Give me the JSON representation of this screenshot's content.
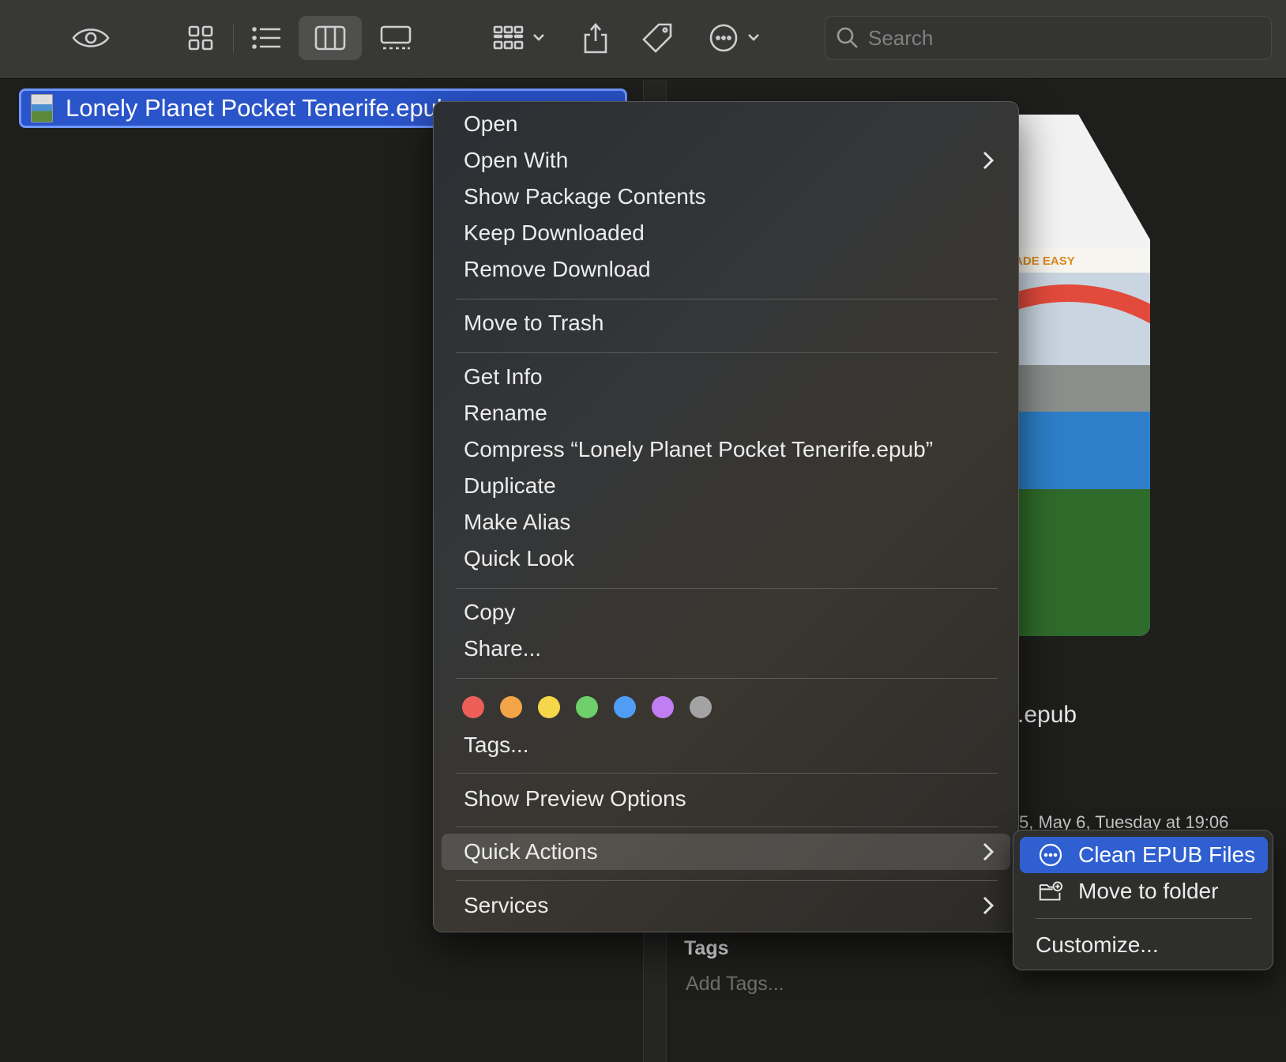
{
  "toolbar": {
    "search_placeholder": "Search",
    "icons": [
      "eye-icon",
      "icon-view-icon",
      "list-view-icon",
      "column-view-icon",
      "gallery-view-icon",
      "group-icon",
      "share-icon",
      "tag-icon",
      "more-icon",
      "search-icon"
    ]
  },
  "file": {
    "name": "Lonely Planet Pocket Tenerife.epub"
  },
  "preview": {
    "cover_band": "E • MADE EASY",
    "title_tail": ".epub",
    "meta_tail": "5, May 6, Tuesday at 19:06",
    "tags_heading": "Tags",
    "add_tags": "Add Tags..."
  },
  "menu": {
    "open": "Open",
    "open_with": "Open With",
    "show_package_contents": "Show Package Contents",
    "keep_downloaded": "Keep Downloaded",
    "remove_download": "Remove Download",
    "move_to_trash": "Move to Trash",
    "get_info": "Get Info",
    "rename": "Rename",
    "compress": "Compress “Lonely Planet Pocket Tenerife.epub”",
    "duplicate": "Duplicate",
    "make_alias": "Make Alias",
    "quick_look": "Quick Look",
    "copy": "Copy",
    "share": "Share...",
    "tags": "Tags...",
    "show_preview_options": "Show Preview Options",
    "quick_actions": "Quick Actions",
    "services": "Services"
  },
  "tag_colors": [
    "#ec5f58",
    "#f4a448",
    "#f7d74a",
    "#6fcf6a",
    "#4f9df5",
    "#c07ef2",
    "#a3a3a3"
  ],
  "submenu": {
    "clean_epub": "Clean EPUB Files",
    "move_to_folder": "Move to folder",
    "customize": "Customize..."
  },
  "colors": {
    "accent": "#2f5fd0",
    "selection": "#2a54c9"
  }
}
